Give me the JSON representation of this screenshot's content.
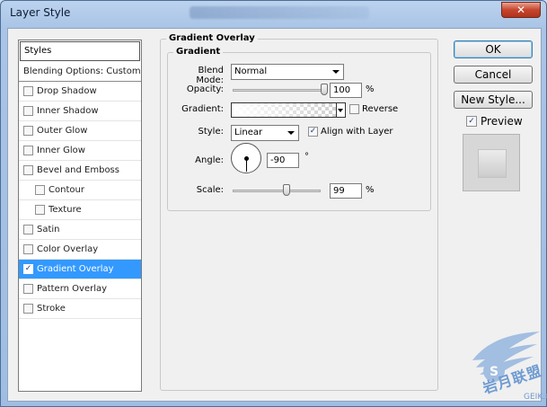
{
  "window": {
    "title": "Layer Style",
    "close_glyph": "✕"
  },
  "styles_panel": {
    "header": "Styles",
    "items": [
      {
        "label": "Blending Options: Custom",
        "checkbox": false,
        "checked": false,
        "sub": false,
        "selected": false
      },
      {
        "label": "Drop Shadow",
        "checkbox": true,
        "checked": false,
        "sub": false,
        "selected": false
      },
      {
        "label": "Inner Shadow",
        "checkbox": true,
        "checked": false,
        "sub": false,
        "selected": false
      },
      {
        "label": "Outer Glow",
        "checkbox": true,
        "checked": false,
        "sub": false,
        "selected": false
      },
      {
        "label": "Inner Glow",
        "checkbox": true,
        "checked": false,
        "sub": false,
        "selected": false
      },
      {
        "label": "Bevel and Emboss",
        "checkbox": true,
        "checked": false,
        "sub": false,
        "selected": false
      },
      {
        "label": "Contour",
        "checkbox": true,
        "checked": false,
        "sub": true,
        "selected": false
      },
      {
        "label": "Texture",
        "checkbox": true,
        "checked": false,
        "sub": true,
        "selected": false
      },
      {
        "label": "Satin",
        "checkbox": true,
        "checked": false,
        "sub": false,
        "selected": false
      },
      {
        "label": "Color Overlay",
        "checkbox": true,
        "checked": false,
        "sub": false,
        "selected": false
      },
      {
        "label": "Gradient Overlay",
        "checkbox": true,
        "checked": true,
        "sub": false,
        "selected": true
      },
      {
        "label": "Pattern Overlay",
        "checkbox": true,
        "checked": false,
        "sub": false,
        "selected": false
      },
      {
        "label": "Stroke",
        "checkbox": true,
        "checked": false,
        "sub": false,
        "selected": false
      }
    ]
  },
  "gradient_overlay": {
    "group_title": "Gradient Overlay",
    "sub_group_title": "Gradient",
    "blend_mode": {
      "label": "Blend Mode:",
      "value": "Normal"
    },
    "opacity": {
      "label": "Opacity:",
      "value": "100",
      "unit": "%",
      "level_percent": 100
    },
    "gradient": {
      "label": "Gradient:",
      "reverse_label": "Reverse",
      "reverse_checked": false
    },
    "style": {
      "label": "Style:",
      "value": "Linear",
      "align_label": "Align with Layer",
      "align_checked": true
    },
    "angle": {
      "label": "Angle:",
      "value": "-90",
      "unit": "°"
    },
    "scale": {
      "label": "Scale:",
      "value": "99",
      "unit": "%",
      "level_percent": 99
    }
  },
  "buttons": {
    "ok": "OK",
    "cancel": "Cancel",
    "new_style": "New Style..."
  },
  "preview": {
    "label": "Preview",
    "checked": true
  },
  "watermark": {
    "text": "岩月联盟",
    "sub": "GEIK.COM"
  },
  "colors": {
    "selection": "#3399ff",
    "dialog_bg": "#f0f0f0",
    "frame": "#a9c4e6"
  }
}
